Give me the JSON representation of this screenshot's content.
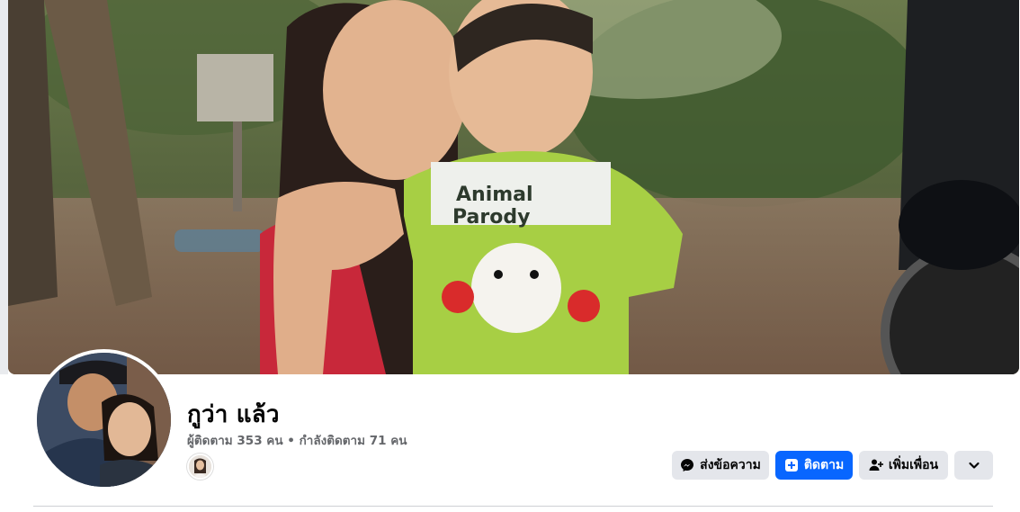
{
  "profile": {
    "name": "กูว่า แล้ว",
    "followers_label": "ผู้ติดตาม",
    "followers_count": "353",
    "followers_unit": "คน",
    "separator": "•",
    "following_label": "กำลังติดตาม",
    "following_count": "71",
    "following_unit": "คน"
  },
  "cover": {
    "shirt_text_line1": "Animal",
    "shirt_text_line2": "Parody"
  },
  "actions": {
    "message_label": "ส่งข้อความ",
    "follow_label": "ติดตาม",
    "add_friend_label": "เพิ่มเพื่อน",
    "more_icon": "chevron-down-icon"
  },
  "colors": {
    "primary": "#0866ff",
    "secondary_button": "#e4e6eb",
    "muted_text": "#65676b"
  }
}
